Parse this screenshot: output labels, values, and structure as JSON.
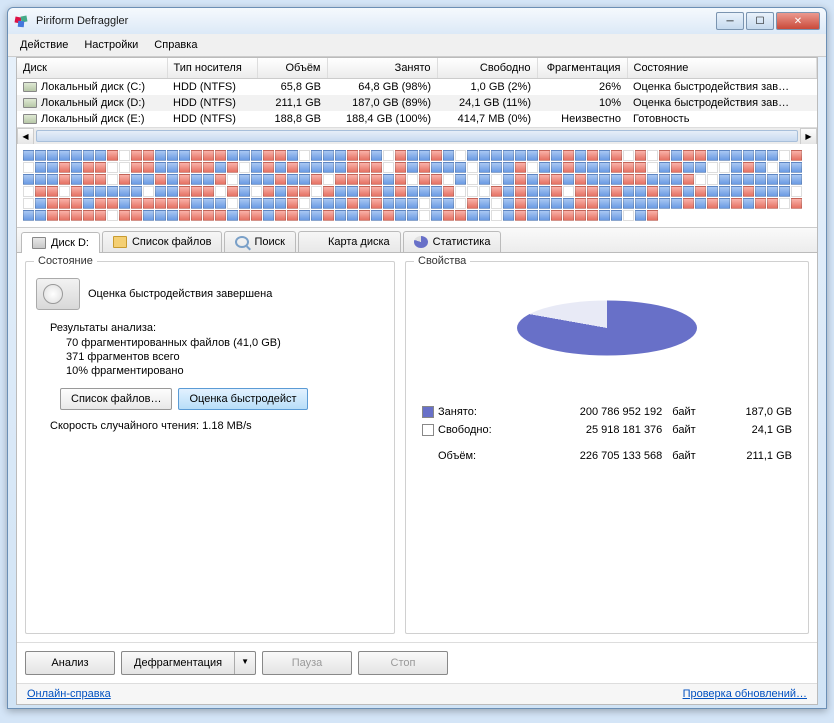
{
  "window": {
    "title": "Piriform Defraggler"
  },
  "menu": {
    "action": "Действие",
    "settings": "Настройки",
    "help": "Справка"
  },
  "columns": {
    "disk": "Диск",
    "media": "Тип носителя",
    "size": "Объём",
    "used": "Занято",
    "free": "Свободно",
    "frag": "Фрагментация",
    "state": "Состояние"
  },
  "drives": [
    {
      "name": "Локальный диск (C:)",
      "media": "HDD (NTFS)",
      "size": "65,8 GB",
      "used": "64,8 GB (98%)",
      "free": "1,0 GB (2%)",
      "frag": "26%",
      "state": "Оценка быстродействия зав…"
    },
    {
      "name": "Локальный диск (D:)",
      "media": "HDD (NTFS)",
      "size": "211,1 GB",
      "used": "187,0 GB (89%)",
      "free": "24,1 GB (11%)",
      "frag": "10%",
      "state": "Оценка быстродействия зав…",
      "selected": true
    },
    {
      "name": "Локальный диск (E:)",
      "media": "HDD (NTFS)",
      "size": "188,8 GB",
      "used": "188,4 GB (100%)",
      "free": "414,7 MB (0%)",
      "frag": "Неизвестно",
      "state": "Готовность"
    }
  ],
  "tabs": {
    "disk": "Диск D:",
    "files": "Список файлов",
    "search": "Поиск",
    "map": "Карта диска",
    "stats": "Статистика"
  },
  "state": {
    "group": "Состояние",
    "headline": "Оценка быстродействия завершена",
    "results_header": "Результаты анализа:",
    "r1": "70  фрагментированных файлов (41,0 GB)",
    "r2": "371  фрагментов всего",
    "r3": "10%  фрагментировано",
    "btn_files": "Список файлов…",
    "btn_bench": "Оценка быстродейст",
    "read_speed": "Скорость случайного чтения: 1.18 MB/s"
  },
  "props": {
    "group": "Свойства",
    "used": "Занято:",
    "free": "Свободно:",
    "total": "Объём:",
    "used_b": "200 786 952 192",
    "free_b": "25 918 181 376",
    "total_b": "226 705 133 568",
    "unit": "байт",
    "used_gb": "187,0 GB",
    "free_gb": "24,1 GB",
    "total_gb": "211,1 GB"
  },
  "buttons": {
    "analyze": "Анализ",
    "defrag": "Дефрагментация",
    "pause": "Пауза",
    "stop": "Стоп"
  },
  "status": {
    "help": "Онлайн-справка",
    "update": "Проверка обновлений…"
  },
  "chart_data": {
    "type": "pie",
    "title": "Свойства",
    "series": [
      {
        "name": "Занято",
        "value": 200786952192,
        "display": "187,0 GB",
        "color": "#6870c8"
      },
      {
        "name": "Свободно",
        "value": 25918181376,
        "display": "24,1 GB",
        "color": "#ffffff"
      }
    ],
    "total": {
      "bytes": 226705133568,
      "display": "211,1 GB"
    }
  }
}
